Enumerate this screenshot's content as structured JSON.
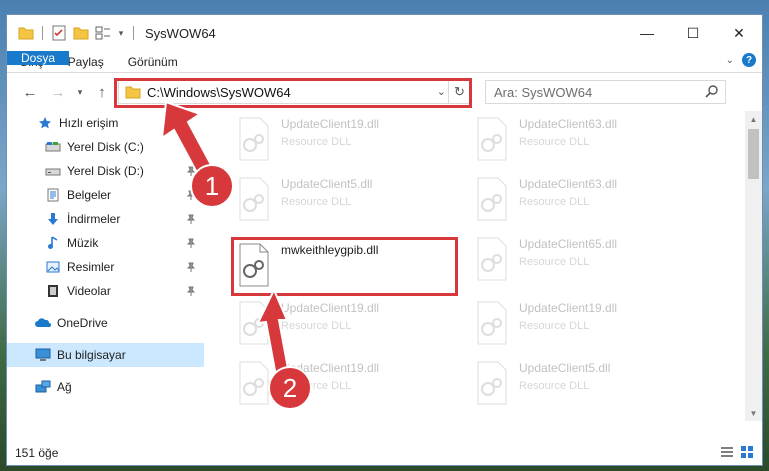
{
  "window": {
    "title": "SysWOW64"
  },
  "window_controls": {
    "minimize": "—",
    "maximize": "☐",
    "close": "✕"
  },
  "ribbon": {
    "tabs": [
      "Dosya",
      "Giriş",
      "Paylaş",
      "Görünüm"
    ],
    "help": "?"
  },
  "address": {
    "path": "C:\\Windows\\SysWOW64"
  },
  "search": {
    "placeholder": "Ara: SysWOW64"
  },
  "sidebar": {
    "items": [
      {
        "label": "Hızlı erişim"
      },
      {
        "label": "Yerel Disk (C:)"
      },
      {
        "label": "Yerel Disk (D:)"
      },
      {
        "label": "Belgeler"
      },
      {
        "label": "İndirmeler"
      },
      {
        "label": "Müzik"
      },
      {
        "label": "Resimler"
      },
      {
        "label": "Videolar"
      },
      {
        "label": "OneDrive"
      },
      {
        "label": "Bu bilgisayar"
      },
      {
        "label": "Ağ"
      }
    ]
  },
  "files": [
    {
      "name": "UpdateClient19.dll",
      "type": "Resource DLL"
    },
    {
      "name": "UpdateClient63.dll",
      "type": "Resource DLL"
    },
    {
      "name": "UpdateClient5.dll",
      "type": "Resource DLL"
    },
    {
      "name": "UpdateClient63.dll",
      "type": "Resource DLL"
    },
    {
      "name": "mwkeithleygpib.dll",
      "type": ""
    },
    {
      "name": "UpdateClient65.dll",
      "type": "Resource DLL"
    },
    {
      "name": "UpdateClient19.dll",
      "type": "Resource DLL"
    },
    {
      "name": "UpdateClient19.dll",
      "type": "Resource DLL"
    },
    {
      "name": "UpdateClient19.dll",
      "type": "Resource DLL"
    },
    {
      "name": "UpdateClient5.dll",
      "type": "Resource DLL"
    }
  ],
  "status": {
    "count": "151 öğe"
  },
  "steps": {
    "one": "1",
    "two": "2"
  },
  "colors": {
    "accent": "#1979ca",
    "highlight": "#d7383b",
    "selected": "#cce8ff"
  }
}
